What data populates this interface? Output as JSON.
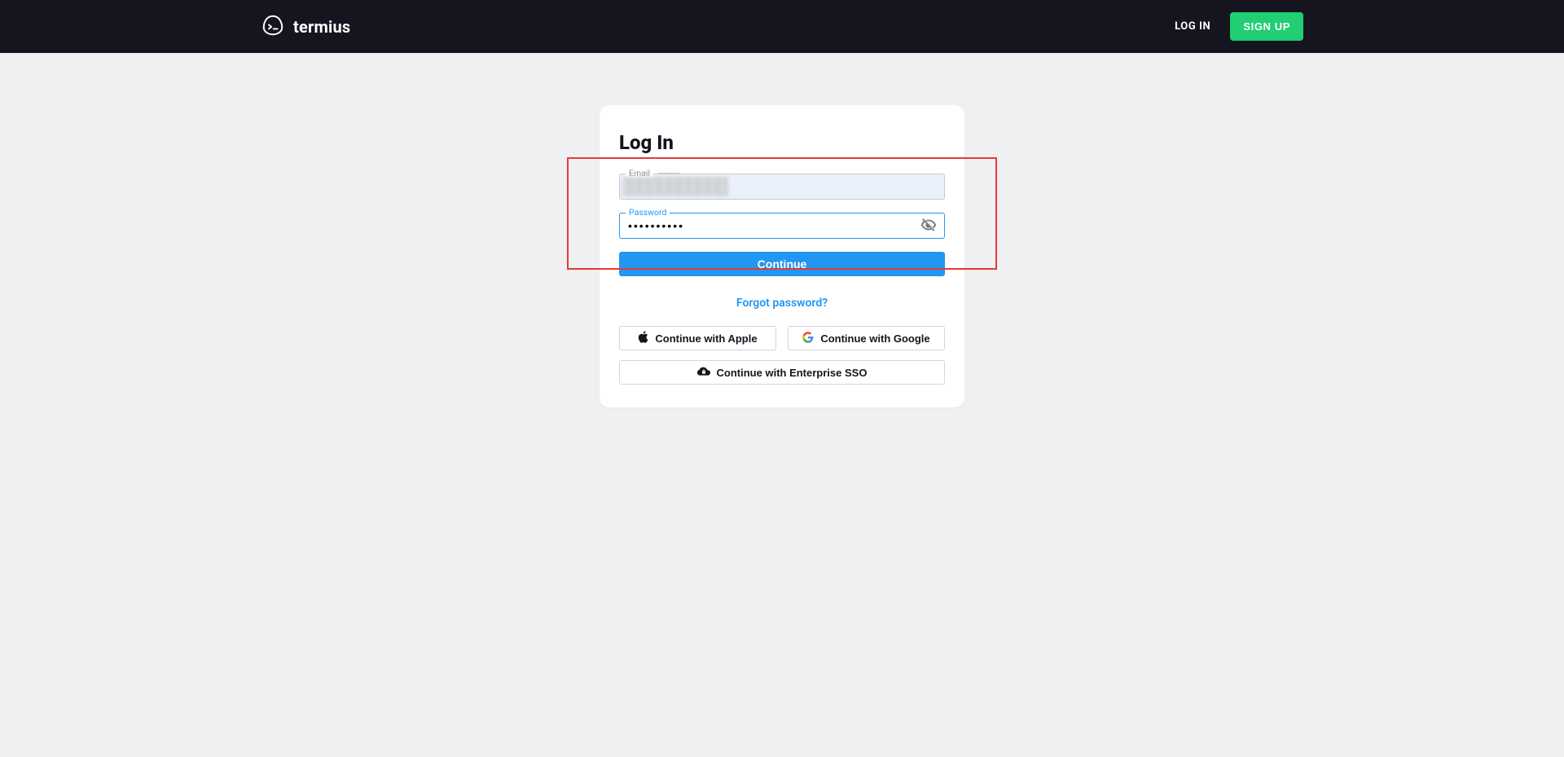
{
  "header": {
    "brand_name": "termius",
    "login_label": "LOG IN",
    "signup_label": "SIGN UP"
  },
  "card": {
    "title": "Log In",
    "email_label": "Email",
    "email_value": "",
    "password_label": "Password",
    "password_value": "••••••••••",
    "continue_label": "Continue",
    "forgot_label": "Forgot password?",
    "apple_label": "Continue with Apple",
    "google_label": "Continue with Google",
    "sso_label": "Continue with Enterprise SSO"
  },
  "colors": {
    "accent": "#2196f3",
    "success": "#21ce74",
    "header_bg": "#14151e",
    "annotation": "#e53935"
  }
}
